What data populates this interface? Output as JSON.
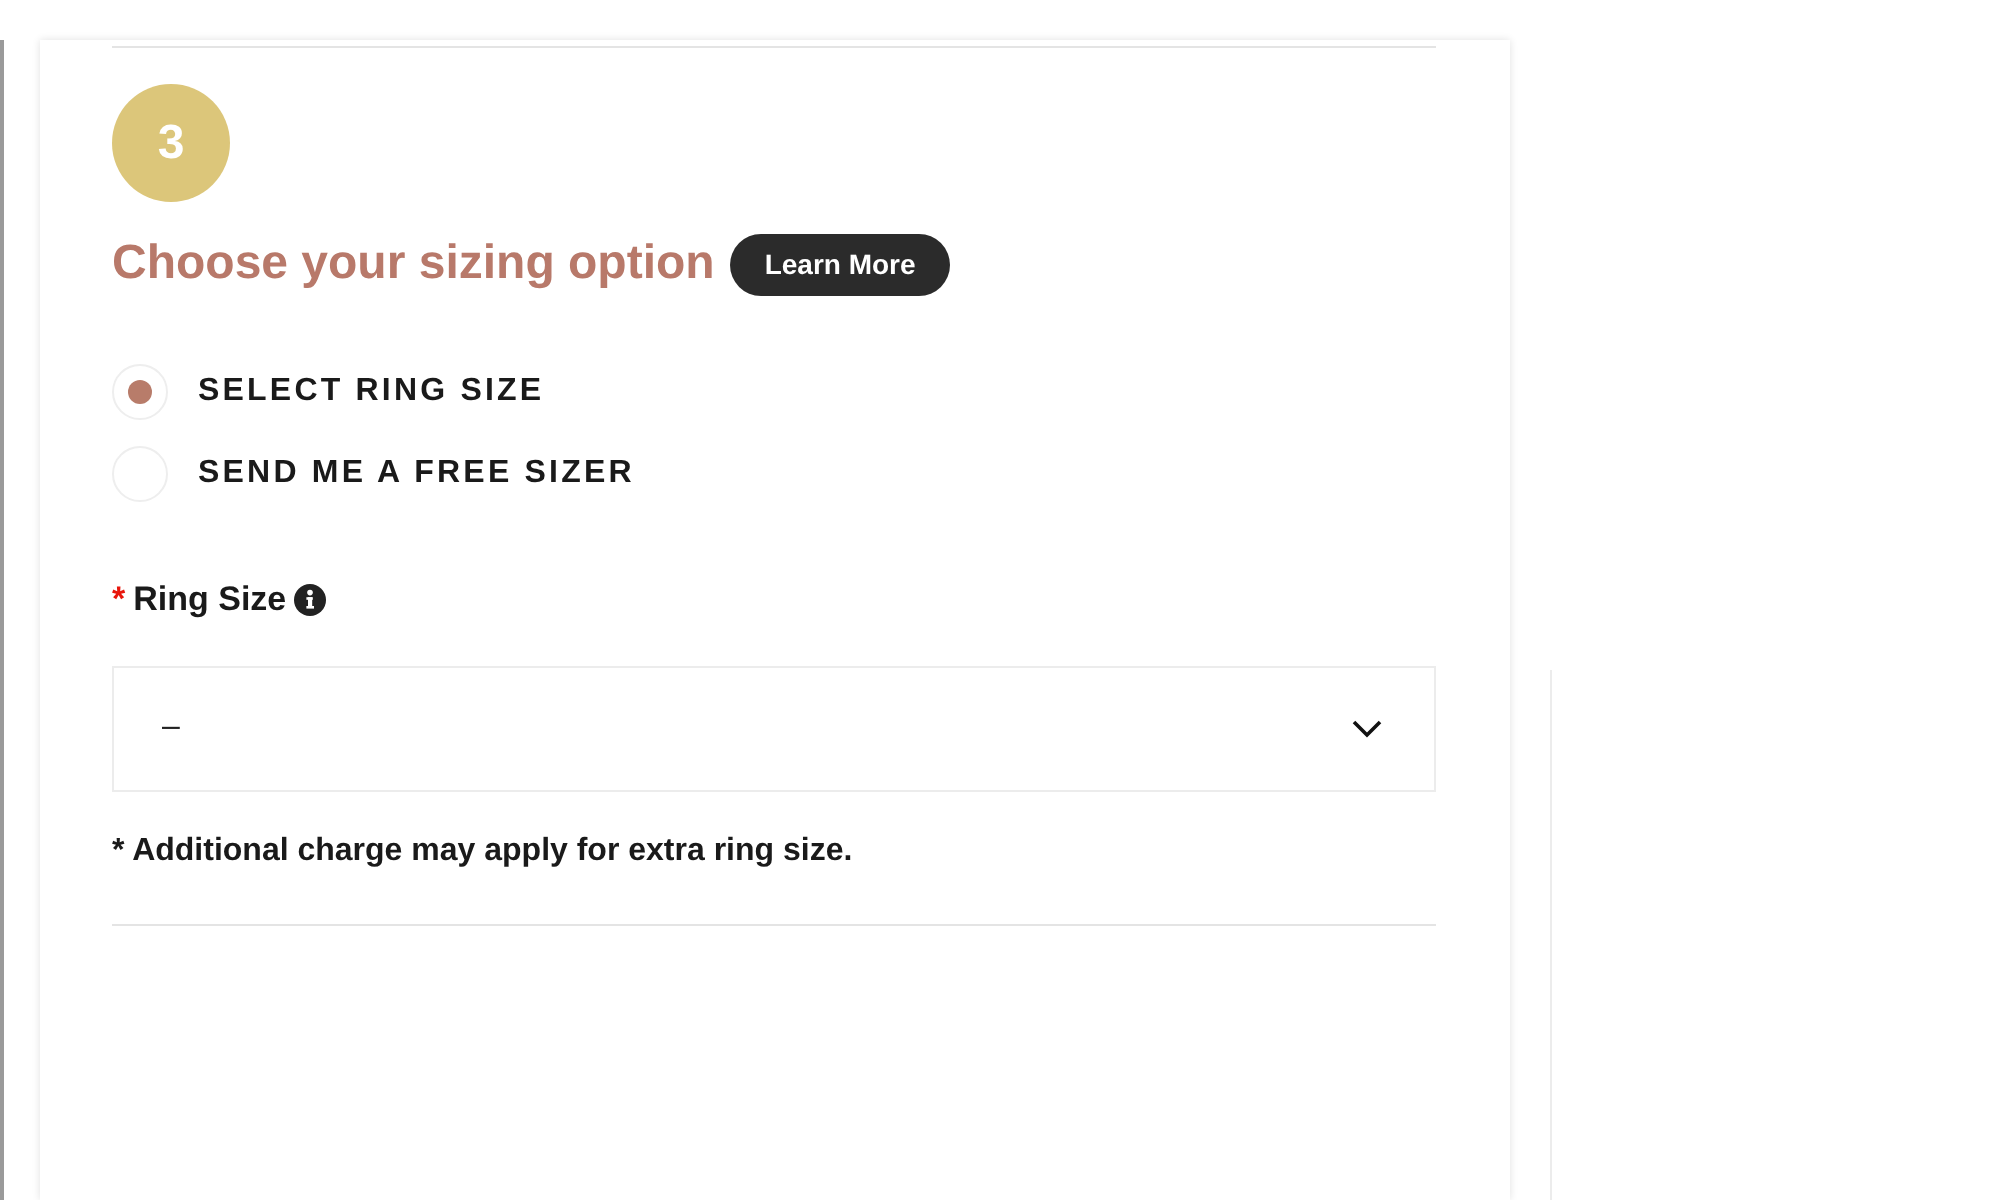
{
  "step": {
    "number": "3",
    "title": "Choose your sizing option",
    "learn_more": "Learn More"
  },
  "options": [
    {
      "label": "SELECT RING SIZE",
      "selected": true
    },
    {
      "label": "SEND ME A FREE SIZER",
      "selected": false
    }
  ],
  "ring_size": {
    "required_mark": "*",
    "label": "Ring Size",
    "value": "–"
  },
  "note": "* Additional charge may apply for extra ring size."
}
